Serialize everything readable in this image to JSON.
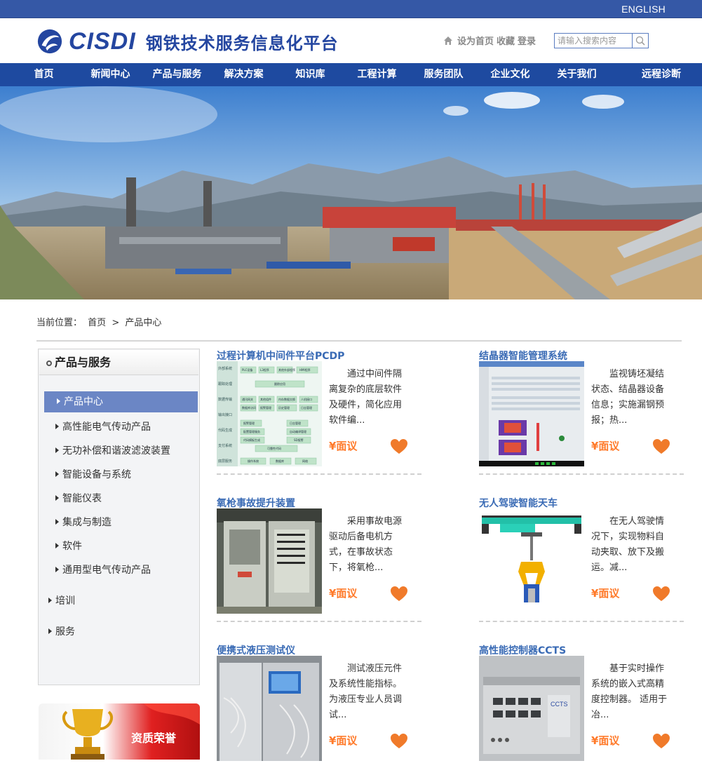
{
  "topbar": {
    "language_link": "ENGLISH"
  },
  "header": {
    "logo_text": "CISDI",
    "site_title": "钢铁技术服务信息化平台",
    "quick_links": [
      "设为首页",
      "收藏",
      "登录"
    ],
    "search_placeholder": "请输入搜索内容"
  },
  "nav": {
    "items": [
      "首页",
      "新闻中心",
      "产品与服务",
      "解决方案",
      "知识库",
      "工程计算",
      "服务团队",
      "企业文化",
      "关于我们",
      "远程诊断"
    ]
  },
  "breadcrumb": {
    "label": "当前位置：",
    "home": "首页",
    "separator": ">",
    "current": "产品中心"
  },
  "sidebar": {
    "title": "产品与服务",
    "active": "产品中心",
    "sub_items": [
      "高性能电气传动产品",
      "无功补偿和谐波滤波装置",
      "智能设备与系统",
      "智能仪表",
      "集成与制造",
      "软件",
      "通用型电气传动产品"
    ],
    "top_items": [
      "培训",
      "服务"
    ],
    "honor_label": "资质荣誉"
  },
  "products": [
    {
      "title": "过程计算机中间件平台PCDP",
      "desc": "通过中间件隔离复杂的底层软件及硬件，简化应用软件编...",
      "price": "¥面议"
    },
    {
      "title": "结晶器智能管理系统",
      "desc": "监视铸坯凝结状态、结晶器设备信息；实施漏钢预报；热...",
      "price": "¥面议"
    },
    {
      "title": "氧枪事故提升装置",
      "desc": "采用事故电源驱动后备电机方式，在事故状态下，将氧枪...",
      "price": "¥面议"
    },
    {
      "title": "无人驾驶智能天车",
      "desc": "在无人驾驶情况下，实现物料自动夹取、放下及搬运。减...",
      "price": "¥面议"
    },
    {
      "title": "便携式液压测试仪",
      "desc": "测试液压元件及系统性能指标。为液压专业人员调试...",
      "price": "¥面议"
    },
    {
      "title": "高性能控制器CCTS",
      "desc": "基于实时操作系统的嵌入式高精度控制器。 适用于冶...",
      "price": "¥面议"
    }
  ],
  "pcdp_diagram": {
    "left_labels": [
      "外部系统",
      "跟踪处理",
      "数据传输",
      "输出接口",
      "代码生成",
      "支付系统",
      "底层服务"
    ],
    "boxes": [
      "PLC设备",
      "L3程序",
      "其他外部程序",
      "HMI程序",
      "跟踪应用",
      "通讯网关",
      "其他组件",
      "内存数据交换",
      "人机接口",
      "数据库访问",
      "报警管理",
      "历史管理",
      "日志管理",
      "报警管理",
      "日志管理",
      "配置管理服务",
      "自动编译管理",
      "代码模板生成",
      "SD报警",
      "可靠性代码",
      "操作系统",
      "数据库",
      "网络"
    ]
  },
  "ccts_label": "CCTS",
  "colors": {
    "brand_blue": "#1e4aa0",
    "topbar_blue": "#3558a6",
    "title_blue": "#3a6bb5",
    "price_orange": "#ff7a2a",
    "heart_orange": "#f07a2a"
  }
}
